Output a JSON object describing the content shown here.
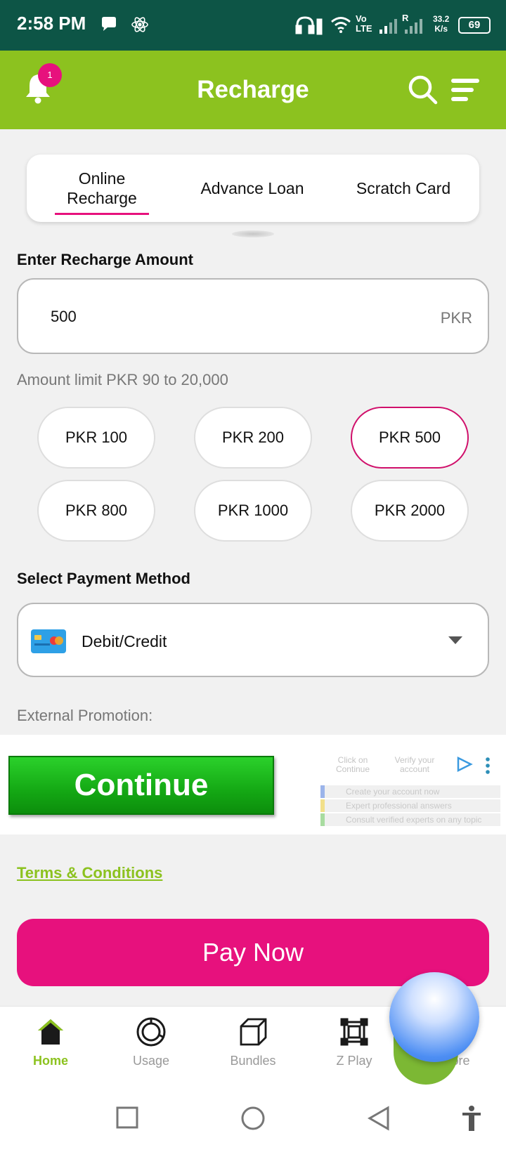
{
  "status_bar": {
    "time": "2:58 PM",
    "network_speed_value": "33.2",
    "network_speed_unit": "K/s",
    "battery": "69",
    "lte_label": "Vo LTE",
    "roaming_label": "R"
  },
  "header": {
    "title": "Recharge",
    "notification_count": "1"
  },
  "tabs": [
    {
      "label": "Online Recharge",
      "active": true
    },
    {
      "label": "Advance Loan",
      "active": false
    },
    {
      "label": "Scratch Card",
      "active": false
    }
  ],
  "amount": {
    "label": "Enter Recharge Amount",
    "value": "500",
    "currency": "PKR",
    "limit_hint": "Amount limit PKR 90 to 20,000"
  },
  "quick_amounts": [
    {
      "label": "PKR 100",
      "selected": false
    },
    {
      "label": "PKR 200",
      "selected": false
    },
    {
      "label": "PKR 500",
      "selected": true
    },
    {
      "label": "PKR 800",
      "selected": false
    },
    {
      "label": "PKR 1000",
      "selected": false
    },
    {
      "label": "PKR 2000",
      "selected": false
    }
  ],
  "payment": {
    "label": "Select Payment Method",
    "selected": "Debit/Credit"
  },
  "promotion": {
    "label": "External Promotion:",
    "ad_button": "Continue",
    "step_1": "Click on Continue",
    "step_2": "Verify your account",
    "line_1": "Create your account now",
    "line_2": "Expert professional answers",
    "line_3": "Consult verified experts on any topic"
  },
  "terms_link": "Terms & Conditions",
  "pay_button": "Pay Now",
  "bottom_nav": [
    {
      "label": "Home",
      "icon": "home-icon",
      "active": true
    },
    {
      "label": "Usage",
      "icon": "usage-icon",
      "active": false
    },
    {
      "label": "Bundles",
      "icon": "bundles-icon",
      "active": false
    },
    {
      "label": "Z Play",
      "icon": "z-play-icon",
      "active": false
    },
    {
      "label": "More",
      "icon": "more-icon",
      "active": false
    }
  ],
  "colors": {
    "brand_green": "#8cc21f",
    "accent_pink": "#e7117d",
    "status_bar": "#0d5546"
  }
}
